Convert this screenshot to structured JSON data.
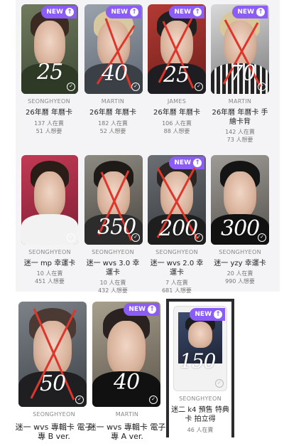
{
  "listings": [
    {
      "member": "SEONGHYEON",
      "title": "26年曆 年曆卡",
      "selling": "137 人在賣",
      "wanted": "51 人想要",
      "new_badge": "NEW",
      "price_mark": "25",
      "crossed": false
    },
    {
      "member": "MARTIN",
      "title": "26年曆 年曆卡",
      "selling": "182 人在賣",
      "wanted": "52 人想要",
      "new_badge": "NEW",
      "price_mark": "40",
      "crossed": true
    },
    {
      "member": "JAMES",
      "title": "26年曆 年曆卡",
      "selling": "106 人在賣",
      "wanted": "88 人想要",
      "new_badge": "NEW",
      "price_mark": "25",
      "crossed": true
    },
    {
      "member": "MARTIN",
      "title": "26年曆 年曆卡 手繪卡背",
      "selling": "142 人在賣",
      "wanted": "73 人想要",
      "new_badge": "NEW",
      "price_mark": "70",
      "crossed": true
    },
    {
      "member": "SEONGHYEON",
      "title": "迷一 mp 幸運卡",
      "selling": "10 人在賣",
      "wanted": "451 人想要",
      "new_badge": "",
      "price_mark": "",
      "crossed": false
    },
    {
      "member": "SEONGHYEON",
      "title": "迷一 wvs 3.0 幸運卡",
      "selling": "10 人在賣",
      "wanted": "432 人想要",
      "new_badge": "",
      "price_mark": "350",
      "crossed": true
    },
    {
      "member": "SEONGHYEON",
      "title": "迷一 wvs 2.0 幸運卡",
      "selling": "7 人在賣",
      "wanted": "681 人想要",
      "new_badge": "NEW",
      "price_mark": "200",
      "crossed": true
    },
    {
      "member": "SEONGHYEON",
      "title": "迷一 yzy 幸運卡",
      "selling": "20 人在賣",
      "wanted": "990 人想要",
      "new_badge": "",
      "price_mark": "300",
      "crossed": false
    },
    {
      "member": "SEONGHYEON",
      "title": "迷一 wvs 專輯卡 電子專 B ver.",
      "selling": "",
      "wanted": "",
      "new_badge": "",
      "price_mark": "50",
      "crossed": true
    },
    {
      "member": "MARTIN",
      "title": "迷一 wvs 專輯卡 電子專 A ver.",
      "selling": "",
      "wanted": "",
      "new_badge": "NEW",
      "price_mark": "40",
      "crossed": false
    },
    {
      "member": "SEONGHYEON",
      "title": "迷二 k4 預售 特典卡 拍立得",
      "selling": "46 人在賣",
      "wanted": "",
      "new_badge": "NEW",
      "price_mark": "150",
      "crossed": false
    }
  ],
  "badge_icon": "arrow-up-icon",
  "check_icon": "check-circle-icon",
  "colors": {
    "badge": "#8b5cf6",
    "cross": "#e0352b"
  }
}
